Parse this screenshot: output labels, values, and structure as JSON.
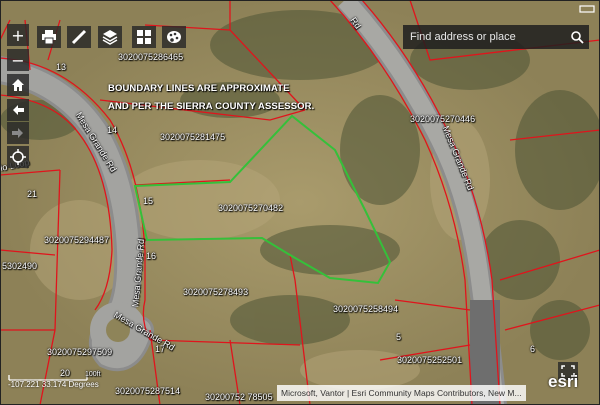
{
  "colors": {
    "parcel_line": "#e0141c",
    "subject_outline": "#35c03a",
    "road": "#8c8c8c",
    "control_bg": "#2a2a2a"
  },
  "notice": {
    "line1": "BOUNDARY LINES ARE APPROXIMATE",
    "line2": "AND PER THE SIERRA COUNTY ASSESSOR."
  },
  "search": {
    "placeholder": "Find address or place",
    "icon": "search-icon"
  },
  "map_controls": {
    "zoom_in": "+",
    "zoom_out": "−",
    "home_icon": "home-icon",
    "back_icon": "arrow-left-icon",
    "forward_icon": "arrow-right-icon",
    "locate_icon": "locate-icon"
  },
  "toolbar": [
    "print-icon",
    "measure-icon",
    "layers-icon",
    "basemap-gallery-icon",
    "palette-icon"
  ],
  "parcels": {
    "p1": "3020075286465",
    "p2": "3020075281475",
    "p3": "3020075270446",
    "p4": "3020075270482",
    "p5": "3020075294487",
    "p6": "5302490",
    "p7": "3020075278493",
    "p8": "3020075258494",
    "p9": "3020075297509",
    "p10": "3020075252501",
    "p11": "3020075287514",
    "p12": "30200752 78505"
  },
  "lot_numbers": {
    "n13": "13",
    "n14": "14",
    "n15": "15",
    "n16": "16",
    "n17": "17",
    "n20": "20",
    "n21": "21",
    "n5": "5",
    "n6": "6"
  },
  "roads": {
    "mesa_grande_1": "Mesa Grande Rd",
    "mesa_grande_2": "Mesa Grande Rd",
    "mesa_grande_3": "Mesa Grande Rd",
    "mesa_grande_4": "Mesa Grande Rd",
    "road_fragment": "Rd",
    "loop_fragment": "lo Loop"
  },
  "status": {
    "coordinates": "-107.221 33.174 Degrees",
    "scale_label": "100ft",
    "attribution": "Microsoft, Vantor | Esri Community Maps Contributors, New M...",
    "logo": "esri"
  }
}
